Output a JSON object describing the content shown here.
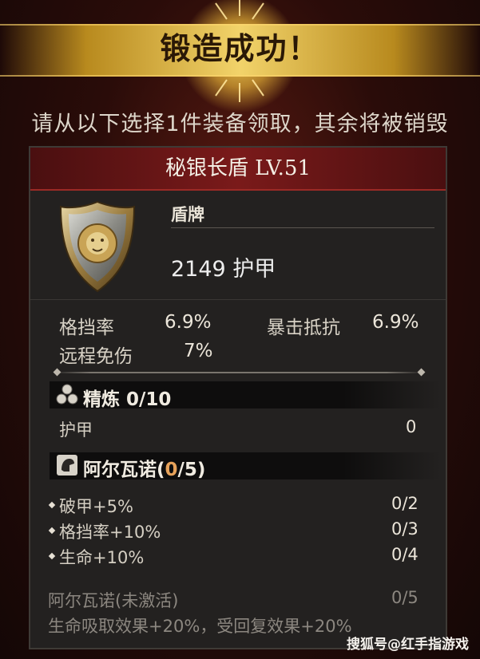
{
  "banner": {
    "title": "锻造成功！"
  },
  "subtitle": "请从以下选择1件装备领取，其余将被销毁",
  "item": {
    "name": "秘银长盾 LV.51",
    "type": "盾牌",
    "armor": "2149 护甲",
    "icon": "lion-shield-icon"
  },
  "stats": [
    {
      "label": "格挡率",
      "value": "6.9%"
    },
    {
      "label": "暴击抵抗",
      "value": "6.9%"
    },
    {
      "label": "远程免伤",
      "value": "7%"
    }
  ],
  "refine": {
    "title": "精炼 0/10",
    "icon": "refine-hexagon-icon",
    "rows": [
      {
        "label": "护甲",
        "value": "0"
      }
    ]
  },
  "set": {
    "title_prefix": "阿尔瓦诺(",
    "title_count": "0",
    "title_suffix": "/5)",
    "icon": "set-helmet-icon",
    "bonuses": [
      {
        "label": "破甲+5%",
        "value": "0/2"
      },
      {
        "label": "格挡率+10%",
        "value": "0/3"
      },
      {
        "label": "生命+10%",
        "value": "0/4"
      }
    ],
    "inactive_label": "阿尔瓦诺(未激活)",
    "inactive_value": "0/5",
    "inactive_desc": "生命吸取效果+20%，受回复效果+20%"
  },
  "watermark": "搜狐号@红手指游戏",
  "colors": {
    "accent_gold": "#f2d36a",
    "header_red": "#7a1a1a",
    "count_orange": "#e7a25a"
  }
}
